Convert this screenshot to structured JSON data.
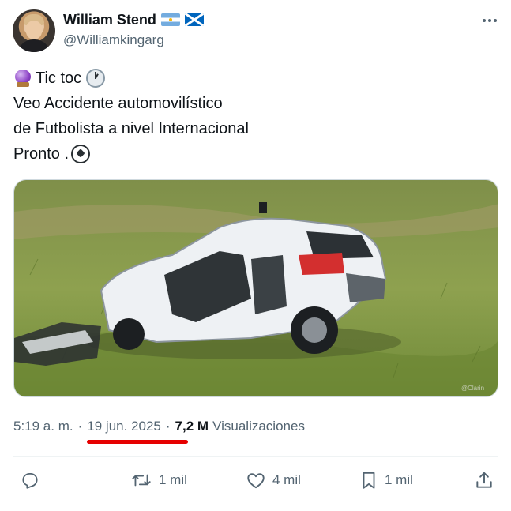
{
  "author": {
    "display_name": "William Stend",
    "handle": "@Williamkingarg",
    "flags": [
      "argentina-flag",
      "scotland-flag"
    ]
  },
  "tweet": {
    "lines": [
      "Tic toc",
      "Veo Accidente automovilístico",
      "de Futbolista a nivel Internacional",
      "Pronto ."
    ],
    "emojis": [
      "crystal-ball-emoji",
      "clock-emoji",
      "soccer-ball-emoji"
    ]
  },
  "media": {
    "description_icon": "photo",
    "watermark": "@Clarin"
  },
  "meta": {
    "time": "5:19 a. m.",
    "separator": "·",
    "date": "19 jun. 2025",
    "views_count": "7,2 M",
    "views_label": "Visualizaciones",
    "underline_color": "#e60000"
  },
  "actions": {
    "reply_count": "",
    "retweet_count": "1 mil",
    "like_count": "4 mil",
    "bookmark_count": "1 mil"
  },
  "colors": {
    "text_primary": "#0f1419",
    "text_secondary": "#536471",
    "divider": "#eff3f4"
  }
}
